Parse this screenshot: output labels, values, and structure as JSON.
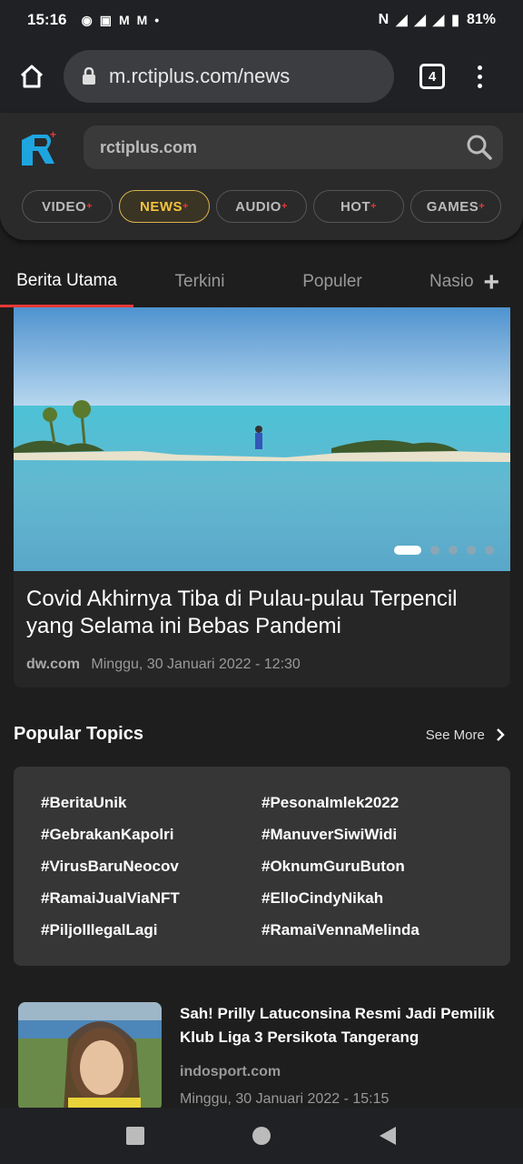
{
  "status": {
    "time": "15:16",
    "battery": "81%"
  },
  "browser": {
    "url": "m.rctiplus.com/news",
    "tab_count": "4"
  },
  "site": {
    "search_placeholder": "rctiplus.com"
  },
  "categories": [
    {
      "label": "VIDEO"
    },
    {
      "label": "NEWS"
    },
    {
      "label": "AUDIO"
    },
    {
      "label": "HOT"
    },
    {
      "label": "GAMES"
    }
  ],
  "tabs": [
    {
      "label": "Berita Utama"
    },
    {
      "label": "Terkini"
    },
    {
      "label": "Populer"
    },
    {
      "label": "Nasio"
    }
  ],
  "hero": {
    "title": "Covid Akhirnya Tiba di Pulau-pulau Terpencil yang Selama ini Bebas Pandemi",
    "source": "dw.com",
    "date": "Minggu, 30 Januari 2022 - 12:30"
  },
  "popular": {
    "title": "Popular Topics",
    "see_more": "See More",
    "topics": [
      "#BeritaUnik",
      "#PesonaImlek2022",
      "#GebrakanKapolri",
      "#ManuverSiwiWidi",
      "#VirusBaruNeocov",
      "#OknumGuruButon",
      "#RamaiJualViaNFT",
      "#ElloCindyNikah",
      "#PiljolIlegalLagi",
      "#RamaiVennaMelinda"
    ]
  },
  "article": {
    "title": "Sah! Prilly Latuconsina Resmi Jadi Pemilik Klub Liga 3 Persikota Tangerang",
    "source": "indosport.com",
    "date": "Minggu, 30 Januari 2022 - 15:15"
  }
}
